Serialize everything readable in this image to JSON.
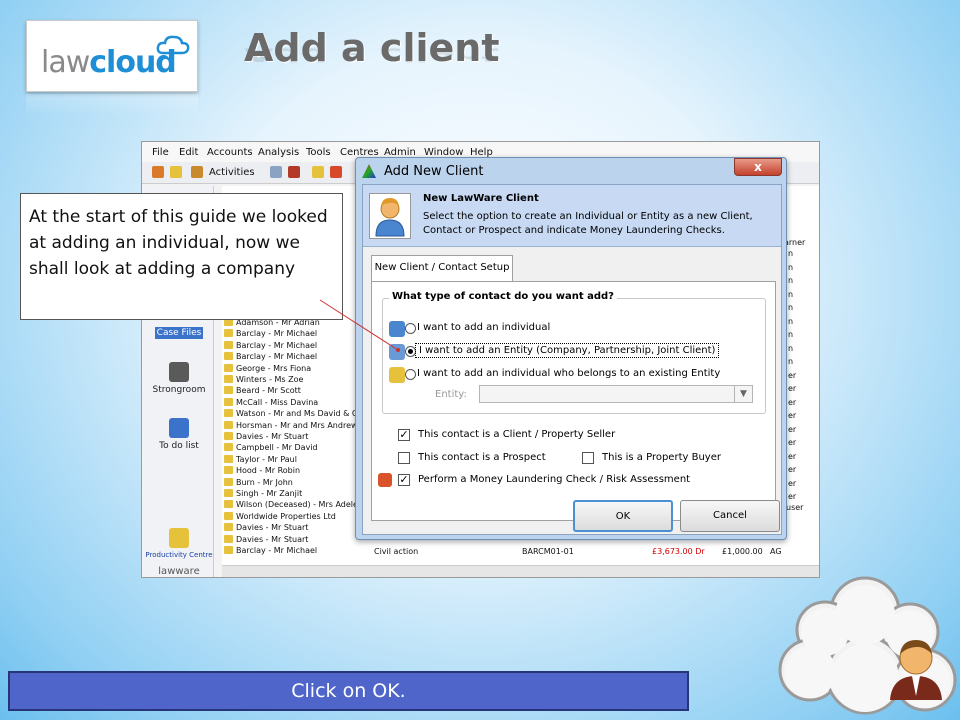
{
  "slide": {
    "title": "Add a client",
    "logo": {
      "law": "law",
      "cloud": "cloud"
    },
    "callout": "At the start of this guide we looked at adding an individual, now we shall look at adding a company",
    "instruction": "Click on OK."
  },
  "app": {
    "menu": [
      "File",
      "Edit",
      "Accounts",
      "Analysis",
      "Tools",
      "Centres",
      "Admin",
      "Window",
      "Help"
    ],
    "toolbar": {
      "activities": "Activities"
    },
    "sidebar": [
      {
        "label": "Case Files",
        "icon": "folder-icon",
        "selected": true
      },
      {
        "label": "Strongroom",
        "icon": "safe-icon",
        "selected": false
      },
      {
        "label": "To do list",
        "icon": "checklist-icon",
        "selected": false
      },
      {
        "label": "Productivity Centre",
        "icon": "productivity-icon",
        "selected": false
      }
    ],
    "brand": "lawware",
    "column_header_partial": "arner",
    "clients": [
      "Adamson - Mr Adrian",
      "Barclay - Mr Michael",
      "Barclay - Mr Michael",
      "Barclay - Mr Michael",
      "George - Mrs Fiona",
      "Winters - Ms Zoe",
      "Beard - Mr Scott",
      "McCall - Miss Davina",
      "Watson - Mr and Ms David & C",
      "Horsman - Mr and Mrs Andrew",
      "Davies - Mr Stuart",
      "Campbell - Mr David",
      "Taylor - Mr Paul",
      "Hood - Mr Robin",
      "Burn - Mr John",
      "Singh - Mr Zanjit",
      "Wilson (Deceased) - Mrs Adele",
      "Worldwide Properties Ltd",
      "Davies - Mr Stuart",
      "Davies - Mr Stuart",
      "Barclay - Mr Michael"
    ],
    "last_row": {
      "matter": "Civil action",
      "ref": "BARCM01-01",
      "balance": "£3,673.00 Dr",
      "fee": "£1,000.00",
      "initials": "AG"
    },
    "right_col": [
      "n",
      "n",
      "n",
      "n",
      "n",
      "n",
      "n",
      "n",
      "n",
      "er",
      "er",
      "er",
      "er",
      "er",
      "er",
      "er",
      "er",
      "er",
      "er"
    ],
    "user_partial": "user"
  },
  "dialog": {
    "title": "Add New Client",
    "close": "x",
    "header_title": "New LawWare Client",
    "header_desc": "Select the option to create an Individual or Entity as a new Client, Contact or Prospect and indicate Money Laundering Checks.",
    "tab": "New Client / Contact Setup",
    "group_title": "What type of contact do you want add?",
    "options": [
      {
        "label": "I want to add an individual",
        "selected": false
      },
      {
        "label": "I want to add an Entity (Company, Partnership, Joint Client)",
        "selected": true
      },
      {
        "label": "I want to add an individual who belongs to an existing Entity",
        "selected": false
      }
    ],
    "entity_label": "Entity:",
    "entity_value": "",
    "checks": {
      "client_seller": {
        "label": "This contact is a Client / Property Seller",
        "checked": true
      },
      "prospect": {
        "label": "This contact is a Prospect",
        "checked": false
      },
      "buyer": {
        "label": "This is a Property Buyer",
        "checked": false
      },
      "money_laundering": {
        "label": "Perform a Money Laundering Check / Risk Assessment",
        "checked": true
      }
    },
    "ok": "OK",
    "cancel": "Cancel"
  },
  "colors": {
    "instruction_bar": "#4f65c9",
    "accent": "#1e8fd6",
    "selected": "#3a73c9"
  }
}
